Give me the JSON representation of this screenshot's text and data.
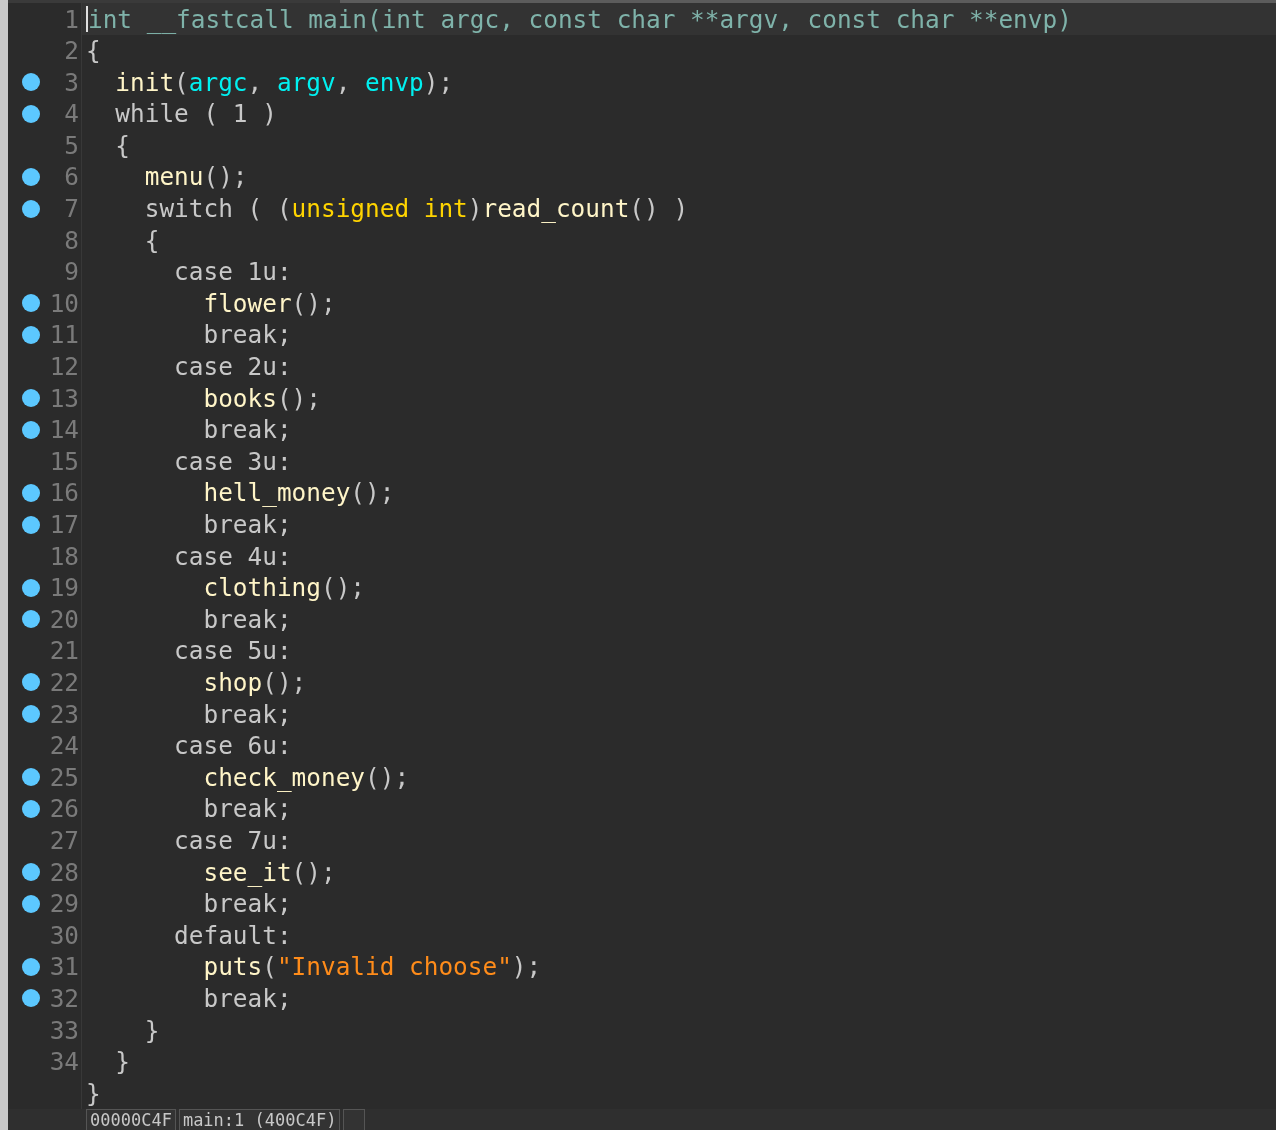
{
  "editor": {
    "lines": [
      {
        "number": "1",
        "breakpoint": false,
        "current": true,
        "tokens": [
          {
            "text": "int __fastcall main(int argc, const char **argv, const char **envp)",
            "kind": "signature"
          }
        ]
      },
      {
        "number": "2",
        "breakpoint": false,
        "current": false,
        "tokens": [
          {
            "text": "{",
            "kind": "plain"
          }
        ]
      },
      {
        "number": "3",
        "breakpoint": true,
        "current": false,
        "tokens": [
          {
            "text": "  init",
            "kind": "func"
          },
          {
            "text": "(",
            "kind": "plain"
          },
          {
            "text": "argc",
            "kind": "arg"
          },
          {
            "text": ", ",
            "kind": "plain"
          },
          {
            "text": "argv",
            "kind": "arg"
          },
          {
            "text": ", ",
            "kind": "plain"
          },
          {
            "text": "envp",
            "kind": "arg"
          },
          {
            "text": ");",
            "kind": "plain"
          }
        ]
      },
      {
        "number": "4",
        "breakpoint": true,
        "current": false,
        "tokens": [
          {
            "text": "  while ( 1 )",
            "kind": "plain"
          }
        ]
      },
      {
        "number": "5",
        "breakpoint": false,
        "current": false,
        "tokens": [
          {
            "text": "  {",
            "kind": "plain"
          }
        ]
      },
      {
        "number": "6",
        "breakpoint": true,
        "current": false,
        "tokens": [
          {
            "text": "    menu",
            "kind": "func"
          },
          {
            "text": "();",
            "kind": "plain"
          }
        ]
      },
      {
        "number": "7",
        "breakpoint": true,
        "current": false,
        "tokens": [
          {
            "text": "    switch ( (",
            "kind": "plain"
          },
          {
            "text": "unsigned int",
            "kind": "type"
          },
          {
            "text": ")",
            "kind": "plain"
          },
          {
            "text": "read_count",
            "kind": "func"
          },
          {
            "text": "() )",
            "kind": "plain"
          }
        ]
      },
      {
        "number": "8",
        "breakpoint": false,
        "current": false,
        "tokens": [
          {
            "text": "    {",
            "kind": "plain"
          }
        ]
      },
      {
        "number": "9",
        "breakpoint": false,
        "current": false,
        "tokens": [
          {
            "text": "      case 1u:",
            "kind": "plain"
          }
        ]
      },
      {
        "number": "10",
        "breakpoint": true,
        "current": false,
        "tokens": [
          {
            "text": "        flower",
            "kind": "func"
          },
          {
            "text": "();",
            "kind": "plain"
          }
        ]
      },
      {
        "number": "11",
        "breakpoint": true,
        "current": false,
        "tokens": [
          {
            "text": "        break;",
            "kind": "plain"
          }
        ]
      },
      {
        "number": "12",
        "breakpoint": false,
        "current": false,
        "tokens": [
          {
            "text": "      case 2u:",
            "kind": "plain"
          }
        ]
      },
      {
        "number": "13",
        "breakpoint": true,
        "current": false,
        "tokens": [
          {
            "text": "        books",
            "kind": "func"
          },
          {
            "text": "();",
            "kind": "plain"
          }
        ]
      },
      {
        "number": "14",
        "breakpoint": true,
        "current": false,
        "tokens": [
          {
            "text": "        break;",
            "kind": "plain"
          }
        ]
      },
      {
        "number": "15",
        "breakpoint": false,
        "current": false,
        "tokens": [
          {
            "text": "      case 3u:",
            "kind": "plain"
          }
        ]
      },
      {
        "number": "16",
        "breakpoint": true,
        "current": false,
        "tokens": [
          {
            "text": "        hell_money",
            "kind": "func"
          },
          {
            "text": "();",
            "kind": "plain"
          }
        ]
      },
      {
        "number": "17",
        "breakpoint": true,
        "current": false,
        "tokens": [
          {
            "text": "        break;",
            "kind": "plain"
          }
        ]
      },
      {
        "number": "18",
        "breakpoint": false,
        "current": false,
        "tokens": [
          {
            "text": "      case 4u:",
            "kind": "plain"
          }
        ]
      },
      {
        "number": "19",
        "breakpoint": true,
        "current": false,
        "tokens": [
          {
            "text": "        clothing",
            "kind": "func"
          },
          {
            "text": "();",
            "kind": "plain"
          }
        ]
      },
      {
        "number": "20",
        "breakpoint": true,
        "current": false,
        "tokens": [
          {
            "text": "        break;",
            "kind": "plain"
          }
        ]
      },
      {
        "number": "21",
        "breakpoint": false,
        "current": false,
        "tokens": [
          {
            "text": "      case 5u:",
            "kind": "plain"
          }
        ]
      },
      {
        "number": "22",
        "breakpoint": true,
        "current": false,
        "tokens": [
          {
            "text": "        shop",
            "kind": "func"
          },
          {
            "text": "();",
            "kind": "plain"
          }
        ]
      },
      {
        "number": "23",
        "breakpoint": true,
        "current": false,
        "tokens": [
          {
            "text": "        break;",
            "kind": "plain"
          }
        ]
      },
      {
        "number": "24",
        "breakpoint": false,
        "current": false,
        "tokens": [
          {
            "text": "      case 6u:",
            "kind": "plain"
          }
        ]
      },
      {
        "number": "25",
        "breakpoint": true,
        "current": false,
        "tokens": [
          {
            "text": "        check_money",
            "kind": "func"
          },
          {
            "text": "();",
            "kind": "plain"
          }
        ]
      },
      {
        "number": "26",
        "breakpoint": true,
        "current": false,
        "tokens": [
          {
            "text": "        break;",
            "kind": "plain"
          }
        ]
      },
      {
        "number": "27",
        "breakpoint": false,
        "current": false,
        "tokens": [
          {
            "text": "      case 7u:",
            "kind": "plain"
          }
        ]
      },
      {
        "number": "28",
        "breakpoint": true,
        "current": false,
        "tokens": [
          {
            "text": "        see_it",
            "kind": "func"
          },
          {
            "text": "();",
            "kind": "plain"
          }
        ]
      },
      {
        "number": "29",
        "breakpoint": true,
        "current": false,
        "tokens": [
          {
            "text": "        break;",
            "kind": "plain"
          }
        ]
      },
      {
        "number": "30",
        "breakpoint": false,
        "current": false,
        "tokens": [
          {
            "text": "      default:",
            "kind": "plain"
          }
        ]
      },
      {
        "number": "31",
        "breakpoint": true,
        "current": false,
        "tokens": [
          {
            "text": "        puts",
            "kind": "func"
          },
          {
            "text": "(",
            "kind": "plain"
          },
          {
            "text": "\"Invalid choose\"",
            "kind": "string"
          },
          {
            "text": ");",
            "kind": "plain"
          }
        ]
      },
      {
        "number": "32",
        "breakpoint": true,
        "current": false,
        "tokens": [
          {
            "text": "        break;",
            "kind": "plain"
          }
        ]
      },
      {
        "number": "33",
        "breakpoint": false,
        "current": false,
        "tokens": [
          {
            "text": "    }",
            "kind": "plain"
          }
        ]
      },
      {
        "number": "34",
        "breakpoint": false,
        "current": false,
        "tokens": [
          {
            "text": "  }",
            "kind": "plain"
          }
        ]
      },
      {
        "breakpoint": false,
        "current": false,
        "tokens": [
          {
            "text": "}",
            "kind": "plain"
          }
        ]
      }
    ]
  },
  "status_bar": [
    "00000C4F",
    "main:1 (400C4F)"
  ]
}
